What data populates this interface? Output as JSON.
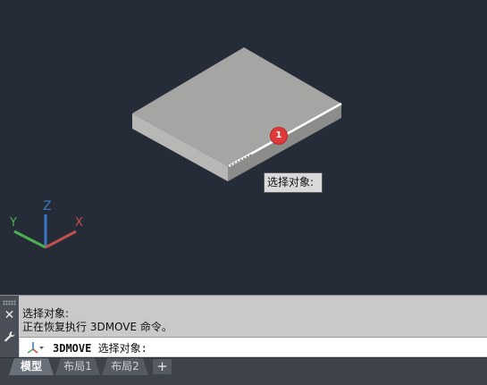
{
  "viewport": {
    "tooltip_text": "选择对象:",
    "marker_number": "1",
    "ucs": {
      "x_label": "X",
      "y_label": "Y",
      "z_label": "Z"
    }
  },
  "command_panel": {
    "history": [
      "选择对象:",
      "正在恢复执行 3DMOVE 命令。"
    ],
    "prompt_command": "3DMOVE",
    "prompt_text": " 选择对象:"
  },
  "tabs": [
    {
      "label": "模型",
      "active": true
    },
    {
      "label": "布局1",
      "active": false
    },
    {
      "label": "布局2",
      "active": false
    }
  ],
  "add_tab_label": "+",
  "colors": {
    "viewport_bg": "#262c37",
    "marker": "#e0393a",
    "axis_x": "#c0504d",
    "axis_y": "#4caf50",
    "axis_z": "#3b78c4"
  }
}
